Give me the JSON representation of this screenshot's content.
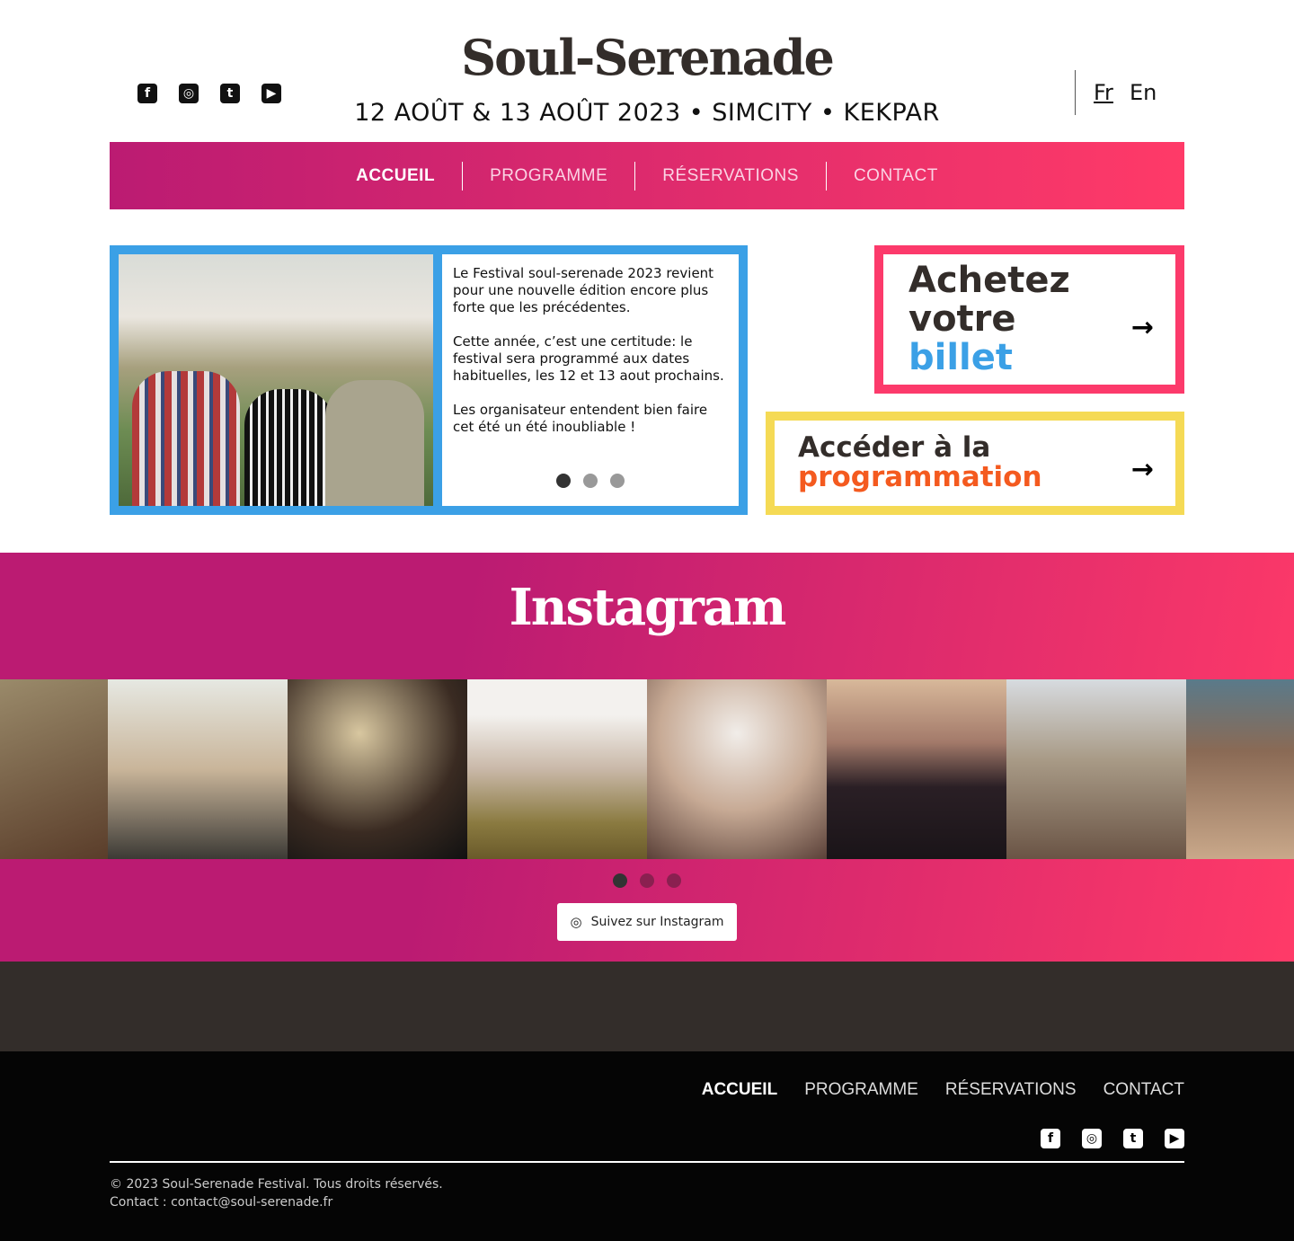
{
  "header": {
    "logo": "Soul-Serenade",
    "dates": "12 AOÛT & 13 AOÛT 2023 • SIMCITY • KEKPAR",
    "lang_fr": "Fr",
    "lang_en": "En",
    "social": [
      "facebook-icon",
      "instagram-icon",
      "twitter-icon",
      "youtube-icon"
    ]
  },
  "nav": [
    "ACCUEIL",
    "PROGRAMME",
    "RÉSERVATIONS",
    "CONTACT"
  ],
  "hero": {
    "p1": "Le Festival soul-serenade 2023 revient pour une nouvelle édition encore plus forte que les précédentes.",
    "p2": "Cette année, c’est une certitude: le festival sera programmé aux dates habituelles, les 12 et 13 aout prochains.",
    "p3": "Les organisateur entendent bien faire cet été un été inoubliable !",
    "slides": 3,
    "active_slide": 1
  },
  "ticket": {
    "line1": "Achetez",
    "line2": "votre",
    "line3": "billet",
    "arrow": "→"
  },
  "program": {
    "line1": "Accéder à la",
    "line2": "programmation",
    "arrow": "→"
  },
  "instagram": {
    "title": "Instagram",
    "button": "Suivez sur Instagram",
    "active_slide": 1
  },
  "footer": {
    "nav": [
      "ACCUEIL",
      "PROGRAMME",
      "RÉSERVATIONS",
      "CONTACT"
    ],
    "copyright": "© 2023 Soul-Serenade Festival. Tous droits réservés.",
    "contact_label": "Contact : ",
    "email": "contact@soul-serenade.fr"
  },
  "colors": {
    "blue": "#3ba0e6",
    "pink": "#fc3a6b",
    "yellow": "#f5da55",
    "orange": "#f45a1f",
    "magenta": "#bb1b72"
  }
}
